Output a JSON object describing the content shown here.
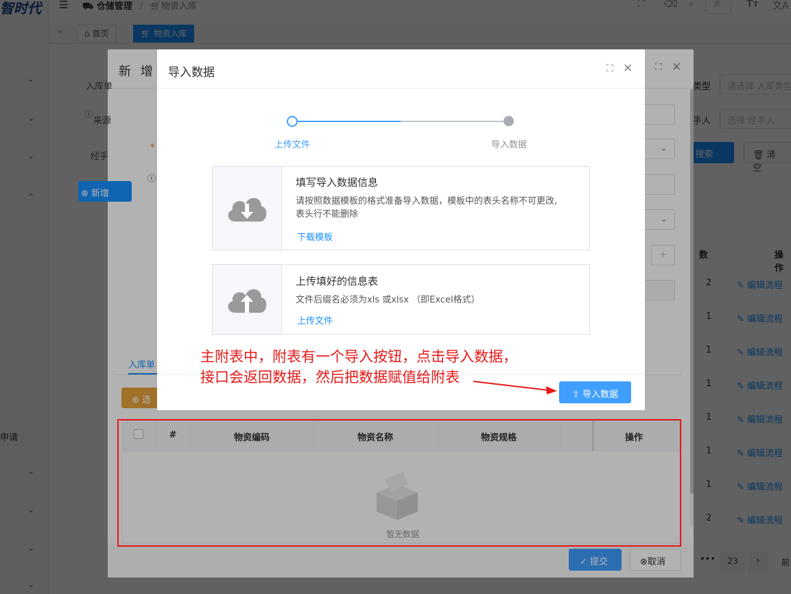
{
  "app": {
    "logo_text": "智时代"
  },
  "topbar": {
    "breadcrumb_parent": "仓储管理",
    "breadcrumb_sep": "/",
    "breadcrumb_current": "物资入库",
    "search_placeholder": "请"
  },
  "tags": {
    "home": "首页",
    "current": "物资入库"
  },
  "sidebar": {
    "item_apply": "申请"
  },
  "background_page": {
    "filter_type_label": "类型",
    "filter_type_placeholder": "请选择 入库类型",
    "filter_handler_label": "手人",
    "filter_handler_placeholder": "选择 经手人",
    "search_button": "搜索",
    "clear_button": "清空",
    "col_count": "数",
    "col_actions": "操作",
    "row_link": "编辑流程",
    "row_counts": [
      "2",
      "1",
      "1",
      "1",
      "1",
      "1",
      "1",
      "2"
    ],
    "pagination_page": "23",
    "pagination_next": "前"
  },
  "dialog_add": {
    "title": "新 增",
    "labels": [
      "入库单",
      "来源",
      "经手",
      "*"
    ],
    "add_button": "新增",
    "table_tab": "入库单",
    "select_button": "选",
    "table_headers": [
      "#",
      "物资编码",
      "物资名称",
      "物资规格",
      "操作"
    ],
    "empty_text": "暂无数据",
    "submit_button": "提交",
    "cancel_button": "取消"
  },
  "dialog_import": {
    "title": "导入数据",
    "steps": [
      {
        "label": "上传文件"
      },
      {
        "label": "导入数据"
      }
    ],
    "card_download": {
      "title": "填写导入数据信息",
      "desc_line1": "请按照数据模板的格式准备导入数据，模板中的表头名称不可更改,",
      "desc_line2": "表头行不能删除",
      "link": "下载模板"
    },
    "card_upload": {
      "title": "上传填好的信息表",
      "desc": "文件后缀名必须为xls 或xlsx （即Excel格式）",
      "link": "上传文件"
    },
    "import_button": "导入数据"
  },
  "annotation": {
    "line1": "主附表中，附表有一个导入按钮，点击导入数据，",
    "line2": "接口会返回数据，然后把数据赋值给附表"
  },
  "colors": {
    "primary": "#409eff",
    "annotation": "#e61919"
  }
}
